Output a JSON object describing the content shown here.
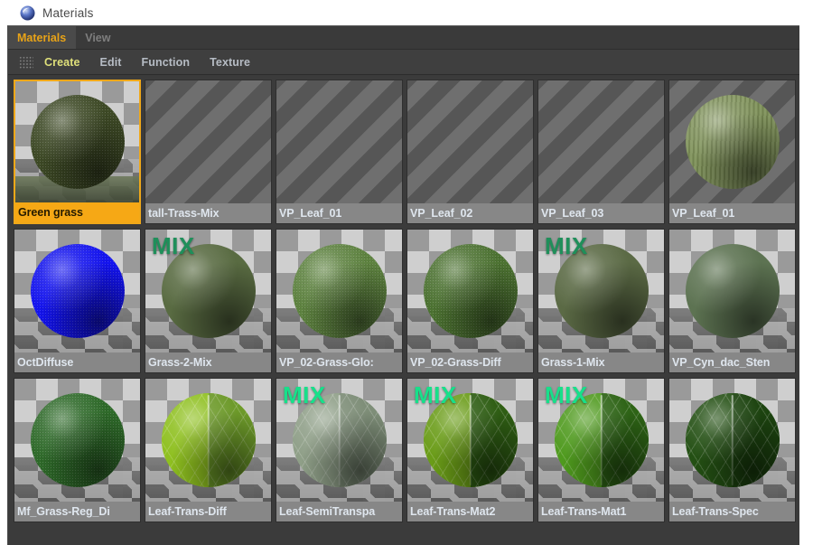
{
  "window": {
    "title": "Materials",
    "icon": "cinema4d-sphere-icon"
  },
  "tabs": [
    {
      "label": "Materials",
      "active": true
    },
    {
      "label": "View",
      "active": false
    }
  ],
  "menubar": {
    "grip_icon": "drag-grip-icon",
    "items": [
      {
        "label": "Create",
        "accent": true
      },
      {
        "label": "Edit",
        "accent": false
      },
      {
        "label": "Function",
        "accent": false
      },
      {
        "label": "Texture",
        "accent": false
      }
    ]
  },
  "colors": {
    "panel_bg": "#3b3b3b",
    "tab_active_text": "#e8a317",
    "tab_inactive_text": "#7e7e7e",
    "menu_text": "#b6bcc4",
    "menu_accent": "#dfe07a",
    "selection_border": "#f0a819",
    "selection_label_bg": "#f6a815",
    "label_bg": "#878787",
    "label_text": "#dfe6ee",
    "mix_tag_dark": "#1f8f5a",
    "mix_tag_bright": "#17e08a"
  },
  "grid": {
    "rows": [
      {
        "cells": [
          {
            "name": "Green grass",
            "selected": true,
            "thumb": "sphere",
            "bg": "checker",
            "color": "#3e4a26",
            "mix": null,
            "style": "grass"
          },
          {
            "name": "tall-Trass-Mix",
            "selected": false,
            "thumb": "striped",
            "bg": "striped",
            "color": null,
            "mix": null,
            "style": "none"
          },
          {
            "name": "VP_Leaf_01",
            "selected": false,
            "thumb": "striped",
            "bg": "striped",
            "color": null,
            "mix": null,
            "style": "none"
          },
          {
            "name": "VP_Leaf_02",
            "selected": false,
            "thumb": "striped",
            "bg": "striped",
            "color": null,
            "mix": null,
            "style": "none"
          },
          {
            "name": "VP_Leaf_03",
            "selected": false,
            "thumb": "striped",
            "bg": "striped",
            "color": null,
            "mix": null,
            "style": "none"
          },
          {
            "name": "VP_Leaf_01",
            "selected": false,
            "thumb": "sphere",
            "bg": "striped",
            "color": "#7e9158",
            "mix": null,
            "style": "fiber"
          }
        ]
      },
      {
        "cells": [
          {
            "name": "OctDiffuse",
            "selected": false,
            "thumb": "sphere",
            "bg": "checker",
            "color": "#1414f0",
            "mix": null,
            "style": "noise"
          },
          {
            "name": "Grass-2-Mix",
            "selected": false,
            "thumb": "sphere",
            "bg": "checker",
            "color": "#596b42",
            "mix": "dark",
            "style": "soft"
          },
          {
            "name": "VP_02-Grass-Glo:",
            "selected": false,
            "thumb": "sphere",
            "bg": "checker",
            "color": "#5e8340",
            "mix": null,
            "style": "grass"
          },
          {
            "name": "VP_02-Grass-Diff",
            "selected": false,
            "thumb": "sphere",
            "bg": "checker",
            "color": "#4d7332",
            "mix": null,
            "style": "grass"
          },
          {
            "name": "Grass-1-Mix",
            "selected": false,
            "thumb": "sphere",
            "bg": "checker",
            "color": "#5b6a45",
            "mix": "dark",
            "style": "soft"
          },
          {
            "name": "VP_Cyn_dac_Sten",
            "selected": false,
            "thumb": "sphere",
            "bg": "checker",
            "color": "#5d7352",
            "mix": null,
            "style": "flat"
          }
        ]
      },
      {
        "cells": [
          {
            "name": "Mf_Grass-Reg_Di",
            "selected": false,
            "thumb": "sphere",
            "bg": "checker",
            "color": "#2f6b2a",
            "mix": null,
            "style": "grass"
          },
          {
            "name": "Leaf-Trans-Diff",
            "selected": false,
            "thumb": "leaf",
            "bg": "checker",
            "color": "#8fc020",
            "color2": "#6d9a2a",
            "mix": null,
            "style": "leaf"
          },
          {
            "name": "Leaf-SemiTranspa",
            "selected": false,
            "thumb": "leaf",
            "bg": "checker",
            "color": "#8f9f88",
            "color2": "#7e8e78",
            "mix": "bright",
            "style": "leafdull"
          },
          {
            "name": "Leaf-Trans-Mat2",
            "selected": false,
            "thumb": "leaf",
            "bg": "checker",
            "color": "#6a9c18",
            "color2": "#2f5e14",
            "mix": "bright",
            "style": "leaf"
          },
          {
            "name": "Leaf-Trans-Mat1",
            "selected": false,
            "thumb": "leaf",
            "bg": "checker",
            "color": "#4f9a1e",
            "color2": "#2e6416",
            "mix": "bright",
            "style": "leaf"
          },
          {
            "name": "Leaf-Trans-Spec",
            "selected": false,
            "thumb": "leaf",
            "bg": "checker",
            "color": "#245014",
            "color2": "#1d4410",
            "mix": null,
            "style": "leaf"
          }
        ]
      }
    ]
  }
}
